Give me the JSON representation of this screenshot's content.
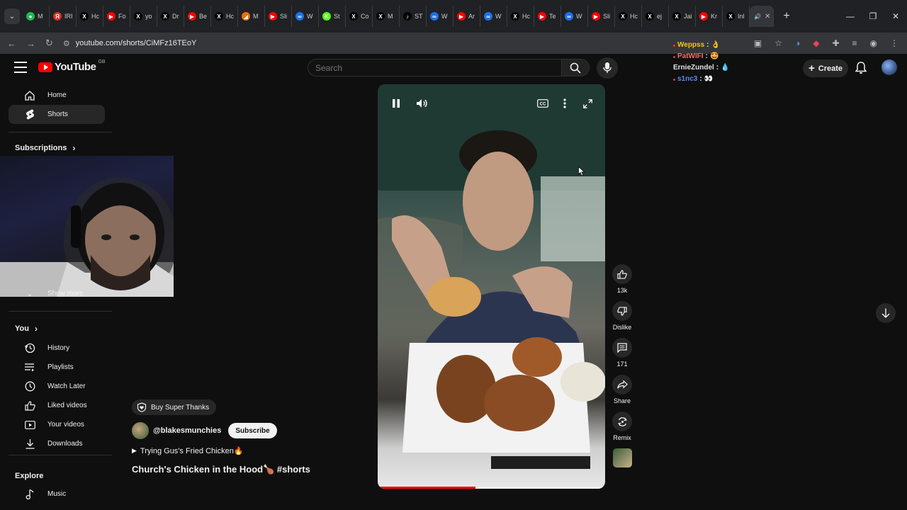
{
  "browser": {
    "tabs": [
      {
        "label": "M",
        "color": "#1db954",
        "glyph": "●"
      },
      {
        "label": "IRI",
        "color": "#d93025",
        "glyph": "Я"
      },
      {
        "label": "Hc",
        "color": "#000000",
        "glyph": "X"
      },
      {
        "label": "Fo",
        "color": "#ff0000",
        "glyph": "▶"
      },
      {
        "label": "yo",
        "color": "#000000",
        "glyph": "X"
      },
      {
        "label": "Dr",
        "color": "#000000",
        "glyph": "X"
      },
      {
        "label": "Be",
        "color": "#ff0000",
        "glyph": "▶"
      },
      {
        "label": "Hc",
        "color": "#000000",
        "glyph": "X"
      },
      {
        "label": "M",
        "color": "#e8710a",
        "glyph": "◢"
      },
      {
        "label": "Sli",
        "color": "#ff0000",
        "glyph": "▶"
      },
      {
        "label": "W",
        "color": "#1a73e8",
        "glyph": "∞"
      },
      {
        "label": "St",
        "color": "#53fc18",
        "glyph": "K"
      },
      {
        "label": "Co",
        "color": "#000000",
        "glyph": "X"
      },
      {
        "label": "M",
        "color": "#000000",
        "glyph": "X"
      },
      {
        "label": "ST",
        "color": "#000000",
        "glyph": "♪"
      },
      {
        "label": "W",
        "color": "#1a73e8",
        "glyph": "∞"
      },
      {
        "label": "Ar",
        "color": "#ff0000",
        "glyph": "▶"
      },
      {
        "label": "W",
        "color": "#1a73e8",
        "glyph": "∞"
      },
      {
        "label": "Hc",
        "color": "#000000",
        "glyph": "X"
      },
      {
        "label": "Te",
        "color": "#ff0000",
        "glyph": "▶"
      },
      {
        "label": "W",
        "color": "#1a73e8",
        "glyph": "∞"
      },
      {
        "label": "Sli",
        "color": "#ff0000",
        "glyph": "▶"
      },
      {
        "label": "Hc",
        "color": "#000000",
        "glyph": "X"
      },
      {
        "label": "ej",
        "color": "#000000",
        "glyph": "X"
      },
      {
        "label": "Jai",
        "color": "#000000",
        "glyph": "X"
      },
      {
        "label": "Kr",
        "color": "#ff0000",
        "glyph": "▶"
      },
      {
        "label": "Inl",
        "color": "#000000",
        "glyph": "X"
      }
    ],
    "active_tab_close": "✕",
    "new_tab": "+",
    "url": "youtube.com/shorts/CiMFz16TEoY",
    "window_controls": [
      "—",
      "❐",
      "✕"
    ]
  },
  "yt": {
    "logo_text": "YouTube",
    "logo_region": "GB",
    "search_placeholder": "Search",
    "create_label": "Create"
  },
  "chat": [
    {
      "user": "Weppss",
      "color": "#f5c518",
      "emoji": "👌"
    },
    {
      "user": "PatWIFI",
      "color": "#ff6b6b",
      "emoji": "🤩"
    },
    {
      "user": "ErnieZundel",
      "color": "#e0e0e0",
      "emoji": "💧"
    },
    {
      "user": "s1nc3",
      "color": "#5b8def",
      "emoji": "👀"
    }
  ],
  "sidebar": {
    "top": [
      {
        "label": "Home",
        "icon": "home-icon"
      },
      {
        "label": "Shorts",
        "icon": "shorts-icon",
        "selected": true
      }
    ],
    "subscriptions_label": "Subscriptions",
    "show_more_label": "Show more",
    "you_label": "You",
    "you_items": [
      {
        "label": "History",
        "icon": "history-icon"
      },
      {
        "label": "Playlists",
        "icon": "playlists-icon"
      },
      {
        "label": "Watch Later",
        "icon": "clock-icon"
      },
      {
        "label": "Liked videos",
        "icon": "thumbs-up-icon"
      },
      {
        "label": "Your videos",
        "icon": "play-icon"
      },
      {
        "label": "Downloads",
        "icon": "download-icon"
      }
    ],
    "explore_label": "Explore",
    "explore_items": [
      {
        "label": "Music",
        "icon": "music-icon"
      }
    ]
  },
  "player": {
    "progress": 0.43
  },
  "actions": {
    "likes": "13k",
    "dislike": "Dislike",
    "comments": "171",
    "share": "Share",
    "remix": "Remix"
  },
  "meta": {
    "super_thanks": "Buy Super Thanks",
    "channel": "@blakesmunchies",
    "subscribe": "Subscribe",
    "sound": "Trying Gus's Fried Chicken🔥",
    "title": "Church's Chicken in the Hood🍗 #shorts"
  }
}
